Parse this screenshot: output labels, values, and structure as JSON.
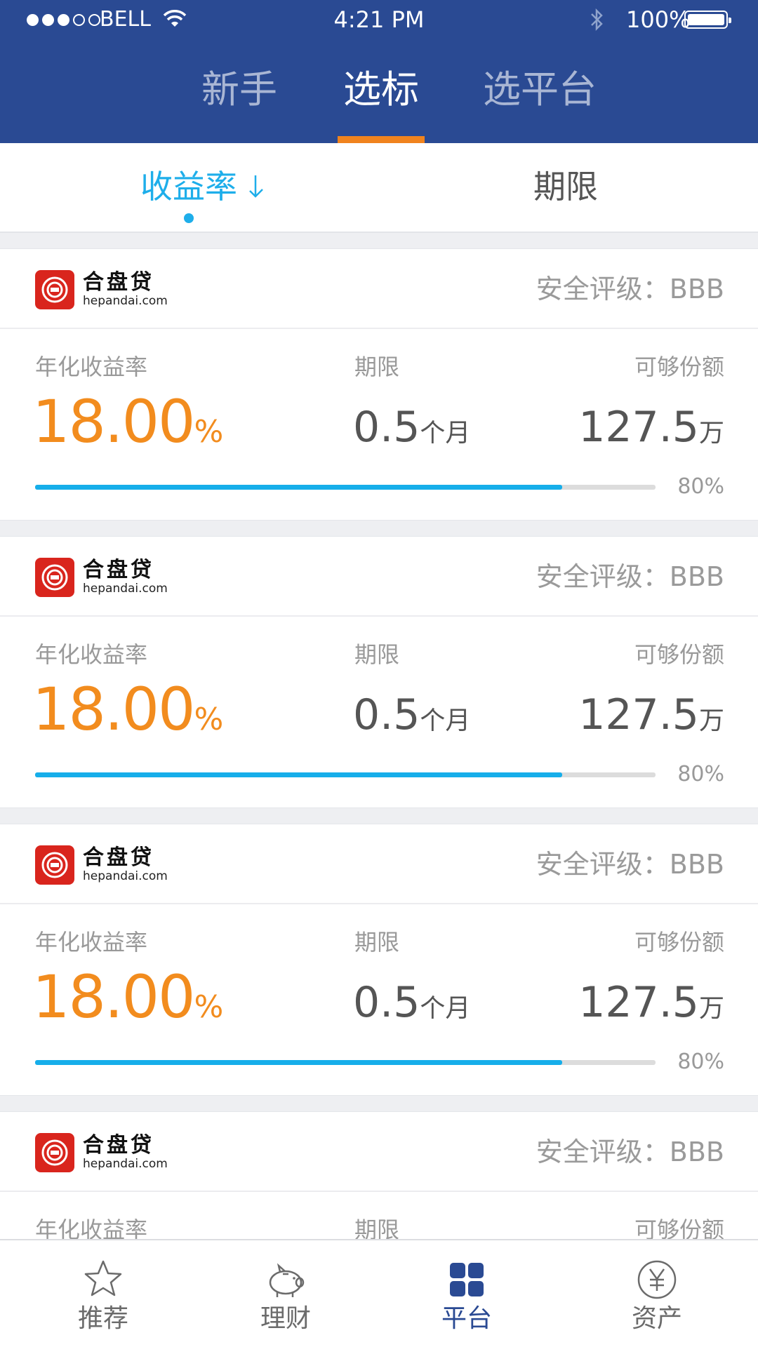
{
  "status_bar": {
    "carrier": "BELL",
    "time": "4:21 PM",
    "battery": "100%"
  },
  "top_tabs": [
    {
      "label": "新手"
    },
    {
      "label": "选标"
    },
    {
      "label": "选平台"
    }
  ],
  "sort_bar": {
    "rate_label": "收益率",
    "term_label": "期限"
  },
  "products": [
    {
      "logo_cn": "合盘贷",
      "logo_en": "hepandai.com",
      "rating": "安全评级：BBB",
      "rate_label": "年化收益率",
      "rate_value": "18.00",
      "rate_unit": "%",
      "term_label": "期限",
      "term_value": "0.5",
      "term_unit": "个月",
      "avail_label": "可够份额",
      "avail_value": "127.5",
      "avail_unit": "万",
      "progress": 0.85,
      "progress_text": "80%"
    },
    {
      "logo_cn": "合盘贷",
      "logo_en": "hepandai.com",
      "rating": "安全评级：BBB",
      "rate_label": "年化收益率",
      "rate_value": "18.00",
      "rate_unit": "%",
      "term_label": "期限",
      "term_value": "0.5",
      "term_unit": "个月",
      "avail_label": "可够份额",
      "avail_value": "127.5",
      "avail_unit": "万",
      "progress": 0.85,
      "progress_text": "80%"
    },
    {
      "logo_cn": "合盘贷",
      "logo_en": "hepandai.com",
      "rating": "安全评级：BBB",
      "rate_label": "年化收益率",
      "rate_value": "18.00",
      "rate_unit": "%",
      "term_label": "期限",
      "term_value": "0.5",
      "term_unit": "个月",
      "avail_label": "可够份额",
      "avail_value": "127.5",
      "avail_unit": "万",
      "progress": 0.85,
      "progress_text": "80%"
    },
    {
      "logo_cn": "合盘贷",
      "logo_en": "hepandai.com",
      "rating": "安全评级：BBB",
      "rate_label": "年化收益率",
      "term_label": "期限",
      "avail_label": "可够份额"
    }
  ],
  "bottom_nav": [
    {
      "label": "推荐",
      "icon": "star-icon"
    },
    {
      "label": "理财",
      "icon": "piggy-bank-icon"
    },
    {
      "label": "平台",
      "icon": "grid-icon"
    },
    {
      "label": "资产",
      "icon": "yen-icon"
    }
  ],
  "colors": {
    "header_bg": "#2a4a93",
    "tab_indicator": "#f0831e",
    "accent_blue": "#1eaeea",
    "rate_orange": "#f28c1e"
  }
}
